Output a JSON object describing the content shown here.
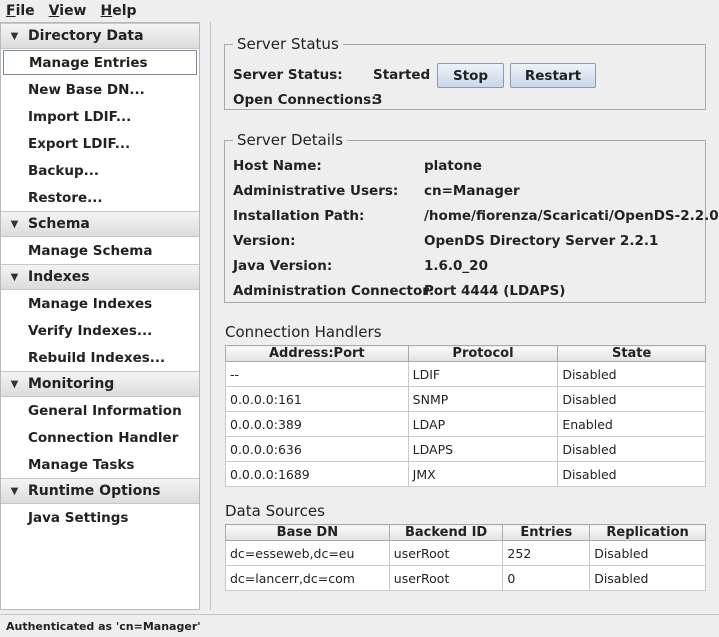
{
  "menubar": {
    "items": [
      {
        "mnemonic": "F",
        "rest": "ile"
      },
      {
        "mnemonic": "V",
        "rest": "iew"
      },
      {
        "mnemonic": "H",
        "rest": "elp"
      }
    ]
  },
  "nav": {
    "sections": [
      {
        "title": "Directory Data",
        "items": [
          "Manage Entries",
          "New Base DN...",
          "Import LDIF...",
          "Export LDIF...",
          "Backup...",
          "Restore..."
        ]
      },
      {
        "title": "Schema",
        "items": [
          "Manage Schema"
        ]
      },
      {
        "title": "Indexes",
        "items": [
          "Manage Indexes",
          "Verify Indexes...",
          "Rebuild Indexes..."
        ]
      },
      {
        "title": "Monitoring",
        "items": [
          "General Information",
          "Connection Handler",
          "Manage Tasks"
        ]
      },
      {
        "title": "Runtime Options",
        "items": [
          "Java Settings"
        ]
      }
    ],
    "selected": "Manage Entries"
  },
  "server_status": {
    "title": "Server Status",
    "status_label": "Server Status:",
    "status_value": "Started",
    "stop_label": "Stop",
    "restart_label": "Restart",
    "connections_label": "Open Connections:",
    "connections_value": "3"
  },
  "server_details": {
    "title": "Server Details",
    "rows": [
      {
        "label": "Host Name:",
        "value": "platone"
      },
      {
        "label": "Administrative Users:",
        "value": "cn=Manager"
      },
      {
        "label": "Installation Path:",
        "value": "/home/fiorenza/Scaricati/OpenDS-2.2.0"
      },
      {
        "label": "Version:",
        "value": "OpenDS Directory Server 2.2.1"
      },
      {
        "label": "Java Version:",
        "value": "1.6.0_20"
      },
      {
        "label": "Administration Connector:",
        "value": "Port 4444 (LDAPS)"
      }
    ]
  },
  "connection_handlers": {
    "title": "Connection Handlers",
    "columns": [
      "Address:Port",
      "Protocol",
      "State"
    ],
    "rows": [
      [
        "--",
        "LDIF",
        "Disabled"
      ],
      [
        "0.0.0.0:161",
        "SNMP",
        "Disabled"
      ],
      [
        "0.0.0.0:389",
        "LDAP",
        "Enabled"
      ],
      [
        "0.0.0.0:636",
        "LDAPS",
        "Disabled"
      ],
      [
        "0.0.0.0:1689",
        "JMX",
        "Disabled"
      ]
    ]
  },
  "data_sources": {
    "title": "Data Sources",
    "columns": [
      "Base DN",
      "Backend ID",
      "Entries",
      "Replication"
    ],
    "rows": [
      [
        "dc=esseweb,dc=eu",
        "userRoot",
        "252",
        "Disabled"
      ],
      [
        "dc=lancerr,dc=com",
        "userRoot",
        "0",
        "Disabled"
      ]
    ]
  },
  "statusbar": {
    "text": "Authenticated as 'cn=Manager'"
  }
}
